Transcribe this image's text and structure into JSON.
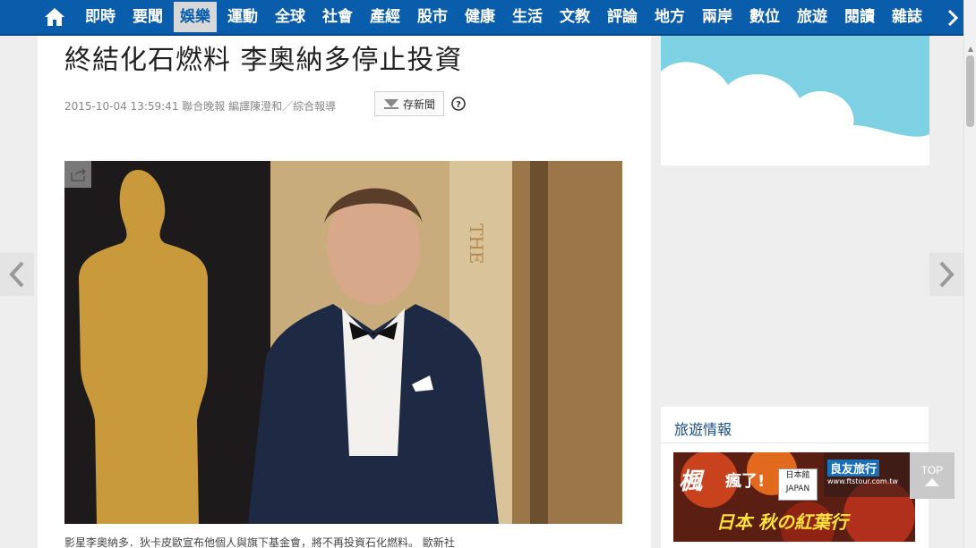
{
  "nav": {
    "items": [
      "即時",
      "要聞",
      "娛樂",
      "運動",
      "全球",
      "社會",
      "產經",
      "股市",
      "健康",
      "生活",
      "文教",
      "評論",
      "地方",
      "兩岸",
      "數位",
      "旅遊",
      "閱讀",
      "雜誌"
    ],
    "active": "娛樂"
  },
  "article": {
    "headline": "終結化石燃料 李奧納多停止投資",
    "meta": "2015-10-04 13:59:41 聯合晚報 編譯陳澄和／綜合報導",
    "save_label": "存新聞",
    "caption": "影星李奧納多．狄卡皮歐宣布他個人與旗下基金會，將不再投資石化燃料。 歐新社",
    "photo_text": "THE"
  },
  "sidebar": {
    "travel_title": "旅遊情報",
    "ad": {
      "t1": "楓",
      "t2": "瘋了!",
      "jp_line1": "日本館",
      "jp_line2": "JAPAN",
      "brand": "良友旅行",
      "url": "www.ftstour.com.tw",
      "t3": "日本 秋の紅葉行"
    }
  },
  "top_button": "TOP"
}
